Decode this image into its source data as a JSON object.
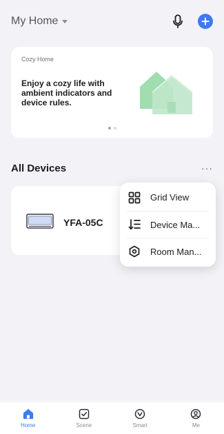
{
  "header": {
    "home_title": "My Home"
  },
  "banner": {
    "label": "Cozy Home",
    "text": "Enjoy a cozy life with ambient indicators and device rules.",
    "page_count": 2,
    "active_page": 1
  },
  "devices": {
    "section_title": "All Devices",
    "more_label": "···",
    "items": [
      {
        "name": "YFA-05C",
        "icon": "air-conditioner-icon"
      }
    ]
  },
  "menu": {
    "items": [
      {
        "label": "Grid View",
        "icon": "grid-icon"
      },
      {
        "label": "Device Ma...",
        "icon": "sort-list-icon"
      },
      {
        "label": "Room Man...",
        "icon": "room-hexagon-icon"
      }
    ]
  },
  "tabbar": {
    "items": [
      {
        "label": "Home",
        "icon": "home-icon",
        "active": true
      },
      {
        "label": "Scene",
        "icon": "scene-check-icon",
        "active": false
      },
      {
        "label": "Smart",
        "icon": "smart-icon",
        "active": false
      },
      {
        "label": "Me",
        "icon": "profile-icon",
        "active": false
      }
    ]
  },
  "colors": {
    "accent": "#3c7bf0",
    "background": "#f3f3f7",
    "card": "#ffffff",
    "banner_art": "#7fcc93"
  }
}
